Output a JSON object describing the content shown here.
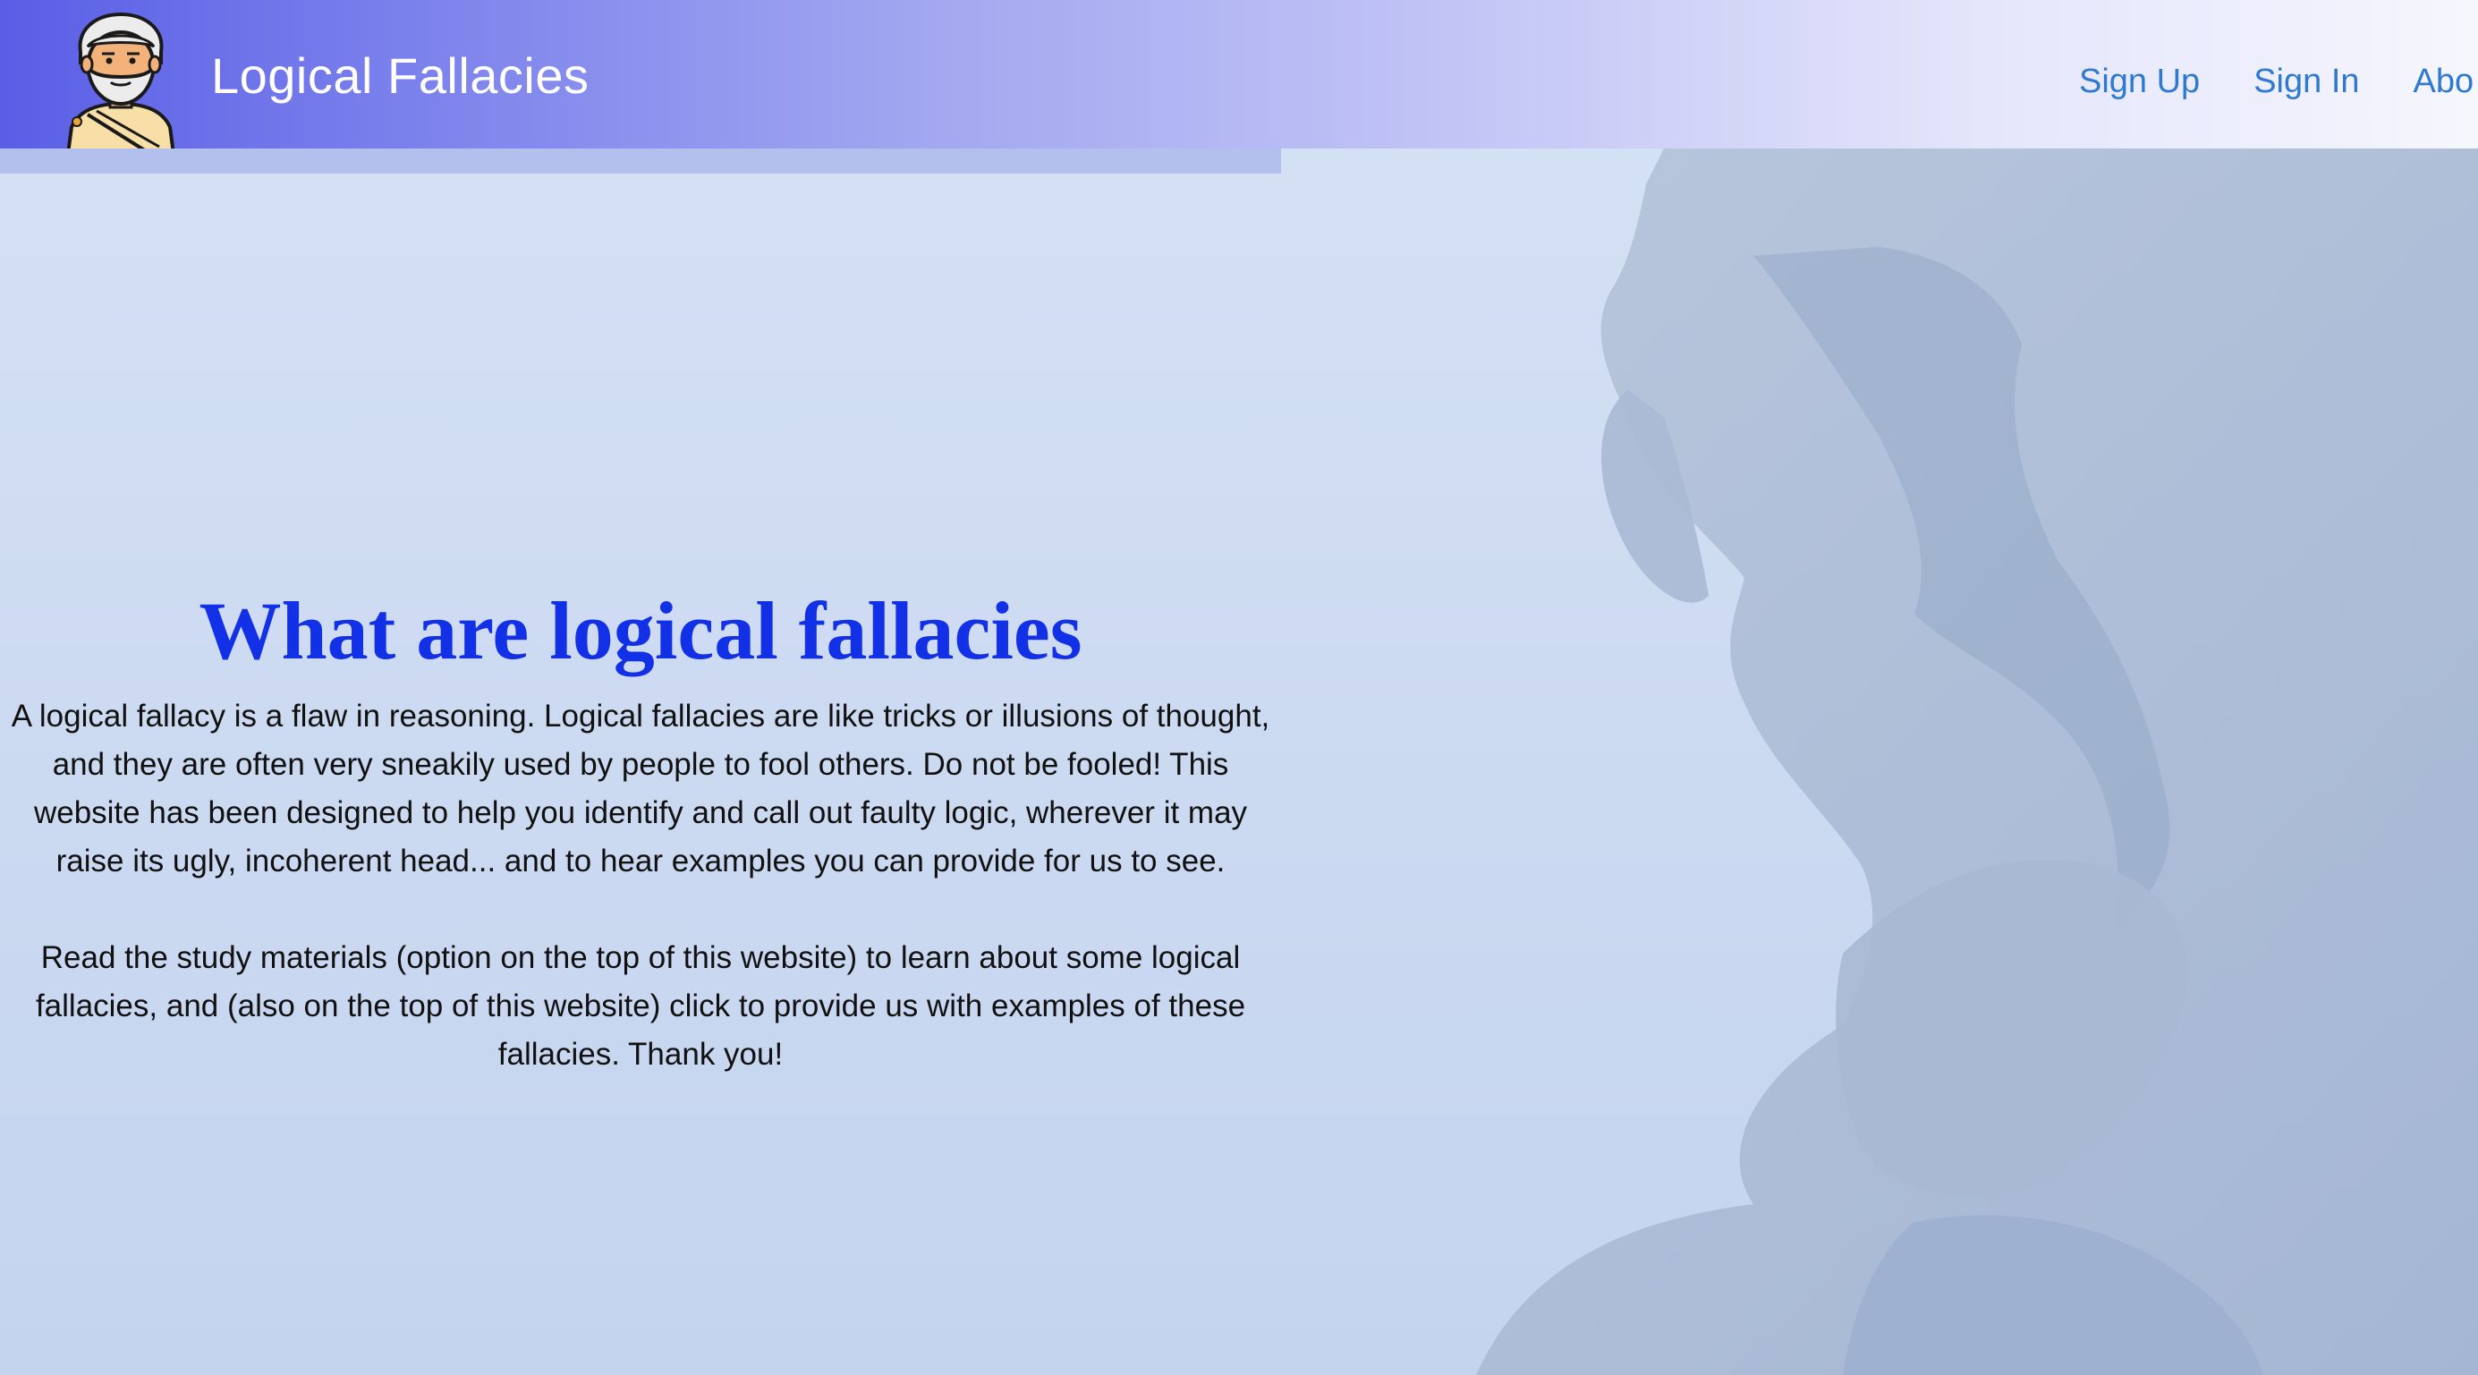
{
  "header": {
    "site_title": "Logical Fallacies",
    "nav": [
      {
        "label": "Sign Up"
      },
      {
        "label": "Sign In"
      },
      {
        "label": "Abo"
      }
    ]
  },
  "main": {
    "heading": "What are logical fallacies",
    "paragraph1": "A logical fallacy is a flaw in reasoning. Logical fallacies are like tricks or illusions of thought, and they are often very sneakily used by people to fool others. Do not be fooled! This website has been designed to help you identify and call out faulty logic, wherever it may raise its ugly, incoherent head... and to hear examples you can provide for us to see.",
    "paragraph2": "Read the study materials (option on the top of this website) to learn about some logical fallacies, and (also on the top of this website) click to provide us with examples of these fallacies. Thank you!"
  },
  "colors": {
    "heading": "#1230e6",
    "nav_link": "#2f7ad1",
    "header_start": "#5a5ee6",
    "header_end": "#f6f6fd"
  }
}
